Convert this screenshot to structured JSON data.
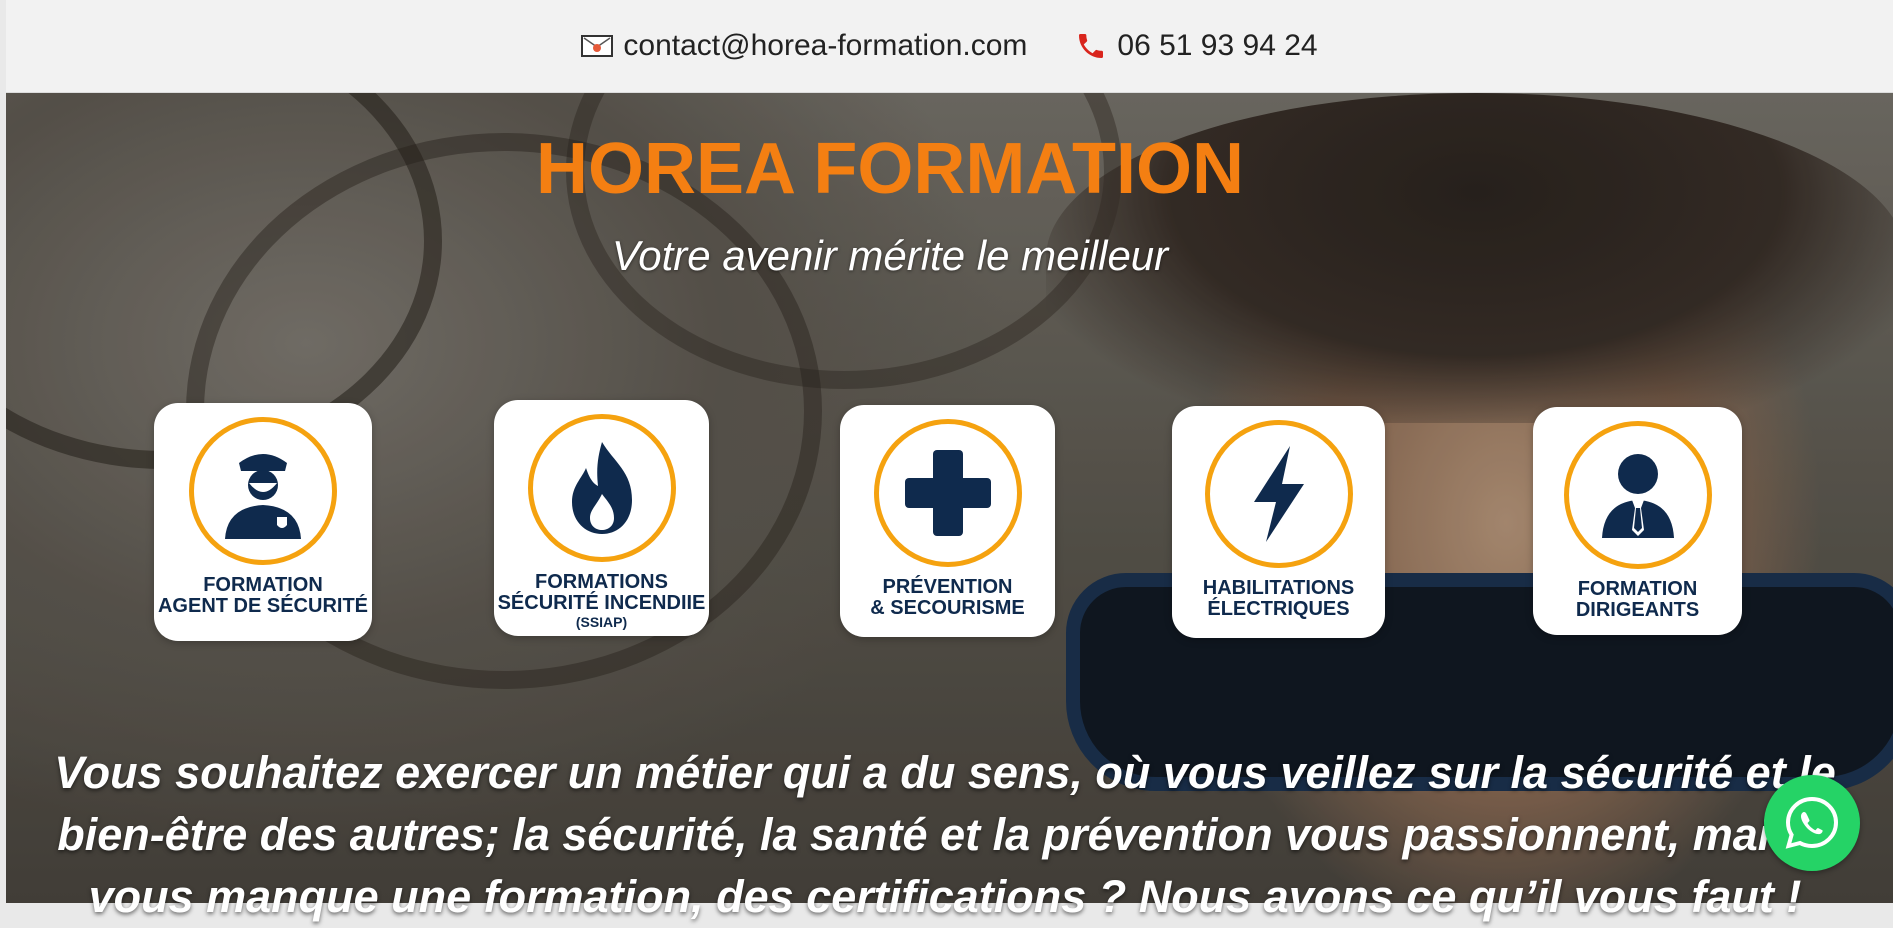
{
  "topbar": {
    "email": "contact@horea-formation.com",
    "phone": "06 51 93 94 24",
    "email_icon": "envelope-icon",
    "phone_icon": "phone-icon"
  },
  "hero": {
    "brand": "HOREA FORMATION",
    "tagline": "Votre avenir mérite le meilleur",
    "body_text": "Vous souhaitez exercer un métier qui a du sens, où vous veillez sur la sécurité et le bien-être des autres; la sécurité, la santé et la prévention vous passionnent, mais il vous manque une formation, des certifications ? Nous avons ce qu’il vous faut !"
  },
  "cards": [
    {
      "line1": "FORMATION",
      "line2": "AGENT DE SÉCURITÉ",
      "sub": "",
      "icon": "security-guard-icon"
    },
    {
      "line1": "FORMATIONS",
      "line2": "SÉCURITÉ INCENDIIE",
      "sub": "(SSIAP)",
      "icon": "flame-icon"
    },
    {
      "line1": "PRÉVENTION",
      "line2": "& SECOURISME",
      "sub": "",
      "icon": "first-aid-cross-icon"
    },
    {
      "line1": "HABILITATIONS",
      "line2": "ÉLECTRIQUES",
      "sub": "",
      "icon": "lightning-bolt-icon"
    },
    {
      "line1": "FORMATION",
      "line2": "DIRIGEANTS",
      "sub": "",
      "icon": "manager-person-icon"
    }
  ],
  "colors": {
    "brand_orange": "#f47f12",
    "ring_orange": "#f5a20f",
    "icon_navy": "#0f2a4d",
    "whatsapp_green": "#25d366"
  },
  "floating": {
    "whatsapp_icon": "whatsapp-icon"
  }
}
